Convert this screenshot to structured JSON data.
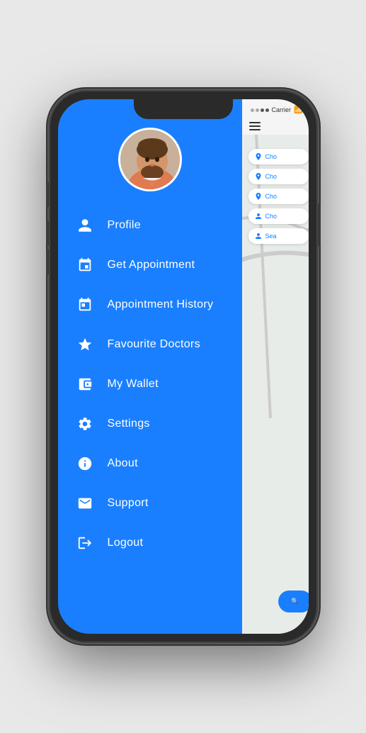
{
  "phone": {
    "status_bar": {
      "signal_dots": [
        false,
        false,
        true,
        true
      ],
      "carrier": "Carrier",
      "wifi_icon": "wifi"
    }
  },
  "menu": {
    "items": [
      {
        "id": "profile",
        "label": "Profile",
        "icon": "person"
      },
      {
        "id": "get-appointment",
        "label": "Get Appointment",
        "icon": "calendar"
      },
      {
        "id": "appointment-history",
        "label": "Appointment History",
        "icon": "calendar-list"
      },
      {
        "id": "favourite-doctors",
        "label": "Favourite Doctors",
        "icon": "star"
      },
      {
        "id": "my-wallet",
        "label": "My Wallet",
        "icon": "wallet"
      },
      {
        "id": "settings",
        "label": "Settings",
        "icon": "gear"
      },
      {
        "id": "about",
        "label": "About",
        "icon": "info"
      },
      {
        "id": "support",
        "label": "Support",
        "icon": "envelope"
      },
      {
        "id": "logout",
        "label": "Logout",
        "icon": "logout"
      }
    ],
    "accent_color": "#1a7fff"
  },
  "content_panel": {
    "chips": [
      {
        "label": "Cho"
      },
      {
        "label": "Cho"
      },
      {
        "label": "Cho"
      },
      {
        "label": "Cho"
      },
      {
        "label": "Sea"
      }
    ],
    "search_button_label": "Search"
  }
}
